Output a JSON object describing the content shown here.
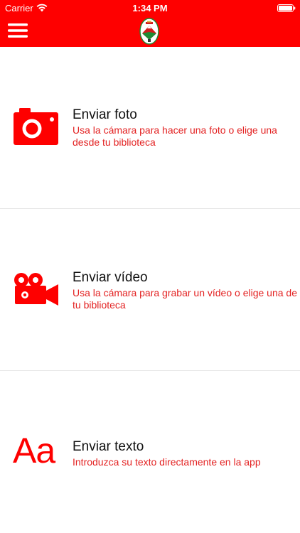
{
  "status_bar": {
    "carrier": "Carrier",
    "time": "1:34 PM",
    "wifi_icon": "wifi-icon",
    "battery_icon": "battery-icon"
  },
  "nav": {
    "menu_icon": "hamburger-menu-icon",
    "logo": "crest-logo"
  },
  "colors": {
    "accent": "#fe0000",
    "description_text": "#e32222",
    "title_text": "#111111",
    "divider": "#e6e6e6"
  },
  "options": [
    {
      "icon": "camera-icon",
      "title": "Enviar foto",
      "description": "Usa la cámara para hacer una foto o elige una desde tu biblioteca"
    },
    {
      "icon": "video-camera-icon",
      "title": "Enviar vídeo",
      "description": "Usa la cámara para grabar un vídeo o elige una de tu biblioteca"
    },
    {
      "icon": "text-icon",
      "icon_text": "Aa",
      "title": "Enviar texto",
      "description": "Introduzca su texto directamente en la app"
    }
  ]
}
